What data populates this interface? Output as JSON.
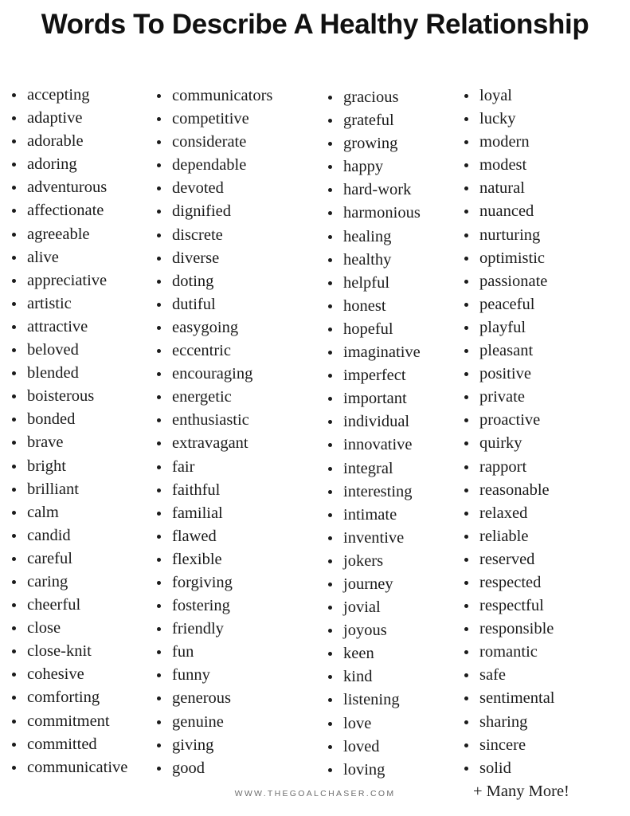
{
  "header": {
    "title": "Words To Describe A Healthy Relationship"
  },
  "footer": {
    "site_url": "WWW.THEGOALCHASER.COM"
  },
  "colors": {
    "background": "#ffffff",
    "text": "#1b1b1b",
    "title": "#111111",
    "footer_text": "#6d6d6d",
    "bullet": "#1b1b1b"
  },
  "word_list": {
    "bullet_glyph": "•",
    "total_columns": 4,
    "closing_note": "+ Many More!",
    "columns": [
      {
        "index": 0,
        "items": [
          "accepting",
          "adaptive",
          "adorable",
          "adoring",
          "adventurous",
          "affectionate",
          "agreeable",
          "alive",
          "appreciative",
          "artistic",
          "attractive",
          "beloved",
          "blended",
          "boisterous",
          "bonded",
          "brave",
          "bright",
          "brilliant",
          "calm",
          "candid",
          "careful",
          "caring",
          "cheerful",
          "close",
          "close-knit",
          "cohesive",
          "comforting",
          "commitment",
          "committed",
          "communicative"
        ]
      },
      {
        "index": 1,
        "items": [
          "communicators",
          "competitive",
          "considerate",
          "dependable",
          "devoted",
          "dignified",
          "discrete",
          "diverse",
          "doting",
          "dutiful",
          "easygoing",
          "eccentric",
          "encouraging",
          "energetic",
          "enthusiastic",
          "extravagant",
          "fair",
          "faithful",
          "familial",
          "flawed",
          "flexible",
          "forgiving",
          "fostering",
          "friendly",
          "fun",
          "funny",
          "generous",
          "genuine",
          "giving",
          "good"
        ]
      },
      {
        "index": 2,
        "items": [
          "gracious",
          "grateful",
          "growing",
          "happy",
          "hard-work",
          "harmonious",
          "healing",
          "healthy",
          "helpful",
          "honest",
          "hopeful",
          "imaginative",
          "imperfect",
          "important",
          "individual",
          "innovative",
          "integral",
          "interesting",
          "intimate",
          "inventive",
          "jokers",
          "journey",
          "jovial",
          "joyous",
          "keen",
          "kind",
          "listening",
          "love",
          "loved",
          "loving"
        ]
      },
      {
        "index": 3,
        "items": [
          "loyal",
          "lucky",
          "modern",
          "modest",
          "natural",
          "nuanced",
          "nurturing",
          "optimistic",
          "passionate",
          "peaceful",
          "playful",
          "pleasant",
          "positive",
          "private",
          "proactive",
          "quirky",
          "rapport",
          "reasonable",
          "relaxed",
          "reliable",
          "reserved",
          "respected",
          "respectful",
          "responsible",
          "romantic",
          "safe",
          "sentimental",
          "sharing",
          "sincere",
          "solid"
        ],
        "trailing_note": "+ Many More!"
      }
    ]
  }
}
